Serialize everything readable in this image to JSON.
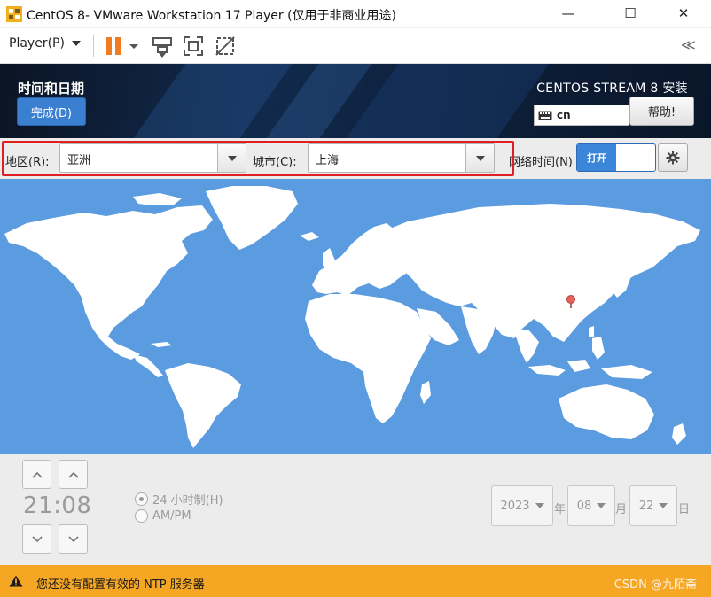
{
  "window": {
    "title": "CentOS 8- VMware Workstation 17 Player (仅用于非商业用途)",
    "minimize_glyph": "—",
    "maximize_glyph": "☐",
    "close_glyph": "✕"
  },
  "toolbar": {
    "player_menu": "Player(P)",
    "collapse_glyph": "≪"
  },
  "header": {
    "page_title": "时间和日期",
    "done_button": "完成(D)",
    "product_name": "CENTOS STREAM 8 安装",
    "keyboard_layout": "cn",
    "help_button": "帮助!"
  },
  "selectors": {
    "region_label": "地区(R):",
    "region_value": "亚洲",
    "city_label": "城市(C):",
    "city_value": "上海",
    "network_time_label": "网络时间(N)",
    "network_time_toggle": "打开"
  },
  "time": {
    "display": "21:08",
    "format_24h": "24 小时制(H)",
    "format_ampm": "AM/PM"
  },
  "date": {
    "year": "2023",
    "year_unit": "年",
    "month": "08",
    "month_unit": "月",
    "day": "22",
    "day_unit": "日"
  },
  "status": {
    "warning": "您还没有配置有效的 NTP 服务器",
    "watermark": "CSDN @九陌斋"
  },
  "colors": {
    "header_bg": "#112a4d",
    "accent_blue": "#3b86d8",
    "ocean": "#5b9be0",
    "land": "#ffffff",
    "warning_bar": "#f5a623",
    "highlight_outline": "#e02020",
    "location_pin": "#e8605a"
  }
}
